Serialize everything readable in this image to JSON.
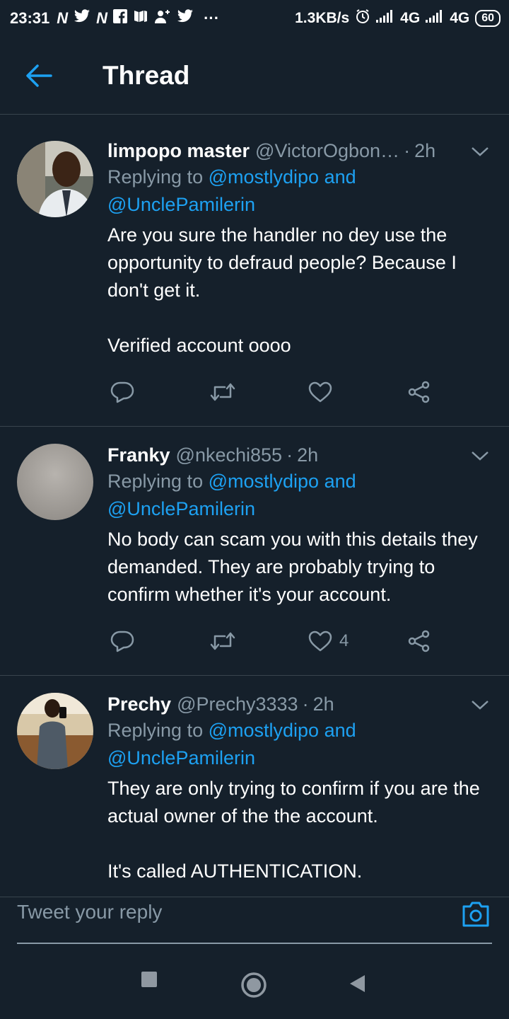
{
  "status_bar": {
    "time": "23:31",
    "network_speed": "1.3KB/s",
    "signal1": "4G",
    "signal2": "4G",
    "battery": "60"
  },
  "header": {
    "title": "Thread"
  },
  "tweets": [
    {
      "name": "limpopo master",
      "handle": "@VictorOgbon…",
      "time": "2h",
      "replying_prefix": "Replying to",
      "mention1": "@mostlydipo and",
      "mention2": "@UnclePamilerin",
      "text": "Are you sure the handler no dey use the opportunity to defraud people? Because I don't get it.\n\nVerified account oooo",
      "like_count": ""
    },
    {
      "name": "Franky",
      "handle": "@nkechi855",
      "time": "2h",
      "replying_prefix": "Replying to",
      "mention1": "@mostlydipo and",
      "mention2": "@UnclePamilerin",
      "text": "No body can scam you with this details they demanded. They are probably trying to confirm whether it's your account.",
      "like_count": "4"
    },
    {
      "name": "Prechy",
      "handle": "@Prechy3333",
      "time": "2h",
      "replying_prefix": "Replying to",
      "mention1": "@mostlydipo and",
      "mention2": "@UnclePamilerin",
      "text": "They are only trying to confirm if you are the actual owner of the the account.\n\nIt's called AUTHENTICATION."
    }
  ],
  "reply_bar": {
    "placeholder": "Tweet your reply"
  },
  "colors": {
    "background": "#15202b",
    "accent": "#1da1f2",
    "muted": "#8899a6",
    "divider": "#38444d"
  }
}
